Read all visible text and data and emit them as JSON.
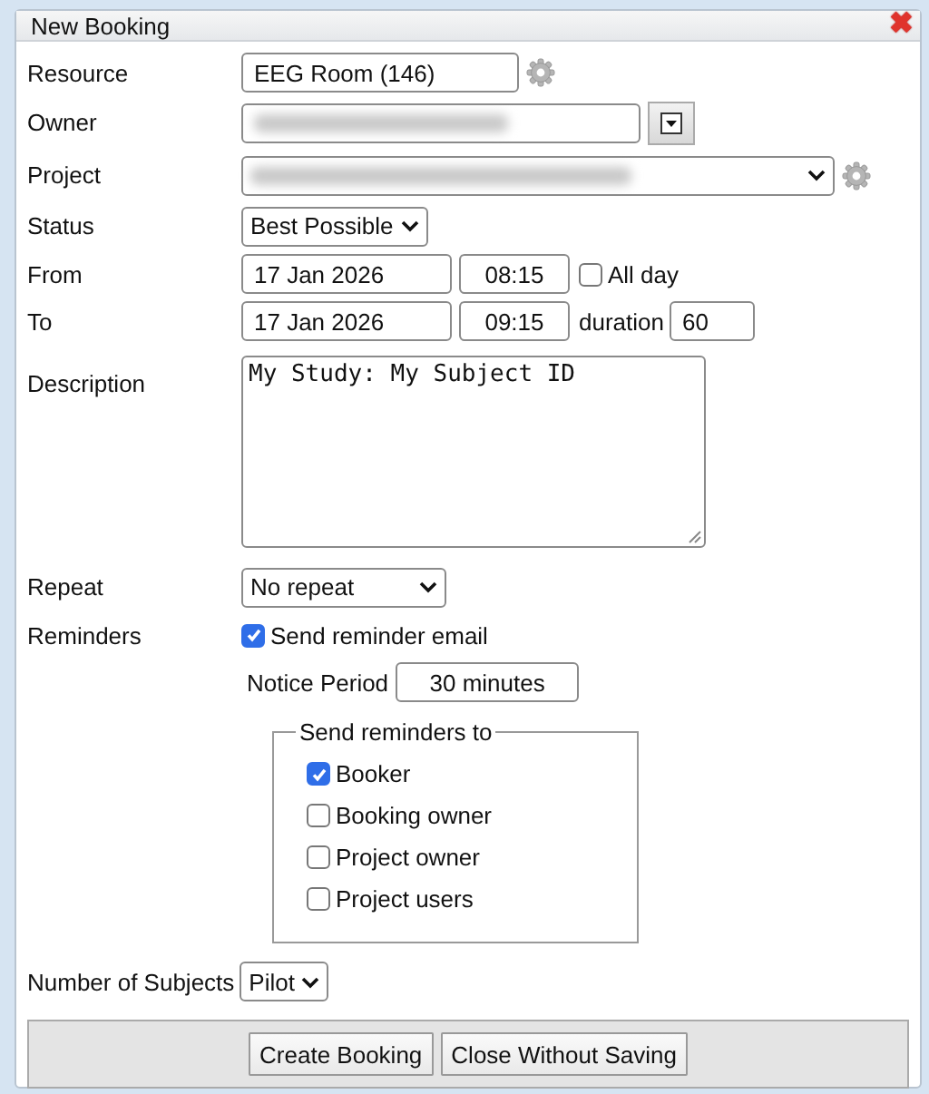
{
  "window": {
    "title": "New Booking",
    "close_icon": "✖"
  },
  "fields": [
    {
      "kind": "text",
      "label": "Resource",
      "value": "EEG Room (146)",
      "settings": true
    },
    {
      "kind": "lookup",
      "label": "Owner",
      "redacted": true
    },
    {
      "kind": "select",
      "label": "Project",
      "redacted": true,
      "settings": true
    },
    {
      "kind": "select",
      "label": "Status",
      "value": "Best Possible"
    },
    {
      "kind": "datetime",
      "label": "From",
      "date": "17 Jan 2026",
      "time": "08:15",
      "extra": {
        "kind": "checkbox",
        "label": "All day",
        "checked": false
      }
    },
    {
      "kind": "datetime",
      "label": "To",
      "date": "17 Jan 2026",
      "time": "09:15",
      "extra": {
        "kind": "input",
        "label": "duration",
        "value": "60"
      }
    },
    {
      "kind": "textarea",
      "label": "Description",
      "value": "My Study: My Subject ID"
    },
    {
      "kind": "select",
      "label": "Repeat",
      "value": "No repeat"
    }
  ],
  "reminders": {
    "label": "Reminders",
    "send_email": {
      "label": "Send reminder email",
      "checked": true
    },
    "notice_label": "Notice Period",
    "notice_value": "30 minutes",
    "legend": "Send reminders to",
    "recipients": [
      {
        "label": "Booker",
        "checked": true
      },
      {
        "label": "Booking owner",
        "checked": false
      },
      {
        "label": "Project owner",
        "checked": false
      },
      {
        "label": "Project users",
        "checked": false
      }
    ]
  },
  "subjects": {
    "label": "Number of Subjects",
    "value": "Pilot"
  },
  "buttons": [
    "Create Booking",
    "Close Without Saving"
  ]
}
